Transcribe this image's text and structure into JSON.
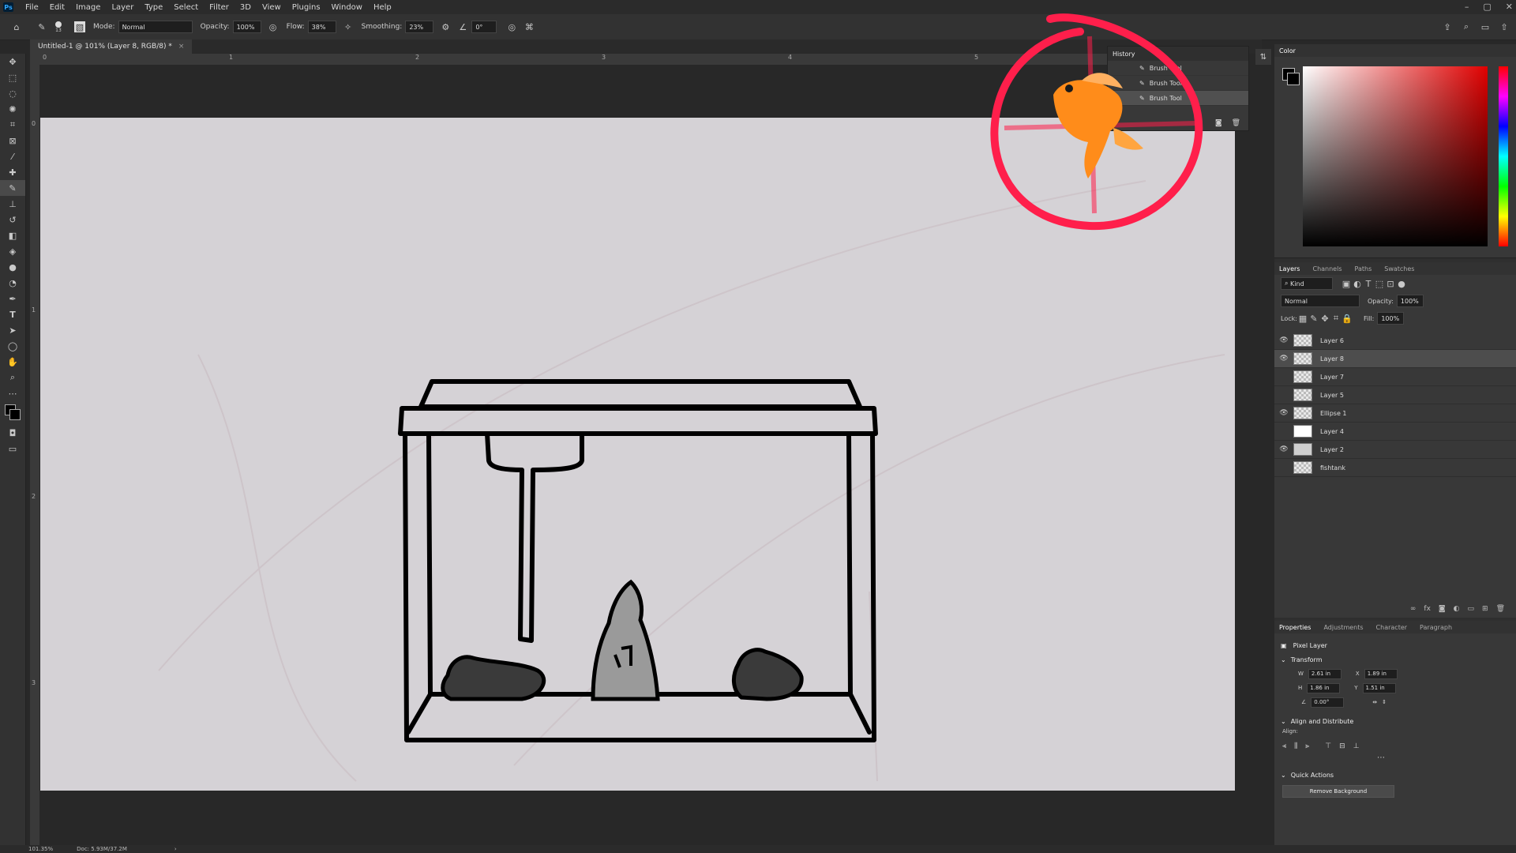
{
  "menu": [
    "File",
    "Edit",
    "Image",
    "Layer",
    "Type",
    "Select",
    "Filter",
    "3D",
    "View",
    "Plugins",
    "Window",
    "Help"
  ],
  "options": {
    "brush_size": "13",
    "mode_label": "Mode:",
    "mode_value": "Normal",
    "opacity_label": "Opacity:",
    "opacity_value": "100%",
    "flow_label": "Flow:",
    "flow_value": "38%",
    "smoothing_label": "Smoothing:",
    "smoothing_value": "23%",
    "angle_value": "0°"
  },
  "document": {
    "tab_title": "Untitled-1 @ 101% (Layer 8, RGB/8) *",
    "ruler_marks": [
      "0",
      "1",
      "2",
      "3",
      "4",
      "5"
    ],
    "ruler_left_marks": [
      "0",
      "1",
      "2",
      "3"
    ]
  },
  "history": {
    "title": "History",
    "items": [
      "Brush Tool",
      "Brush Tool",
      "Brush Tool"
    ]
  },
  "color": {
    "title": "Color"
  },
  "layers": {
    "tabs": [
      "Layers",
      "Channels",
      "Paths",
      "Swatches"
    ],
    "kind_label": "Kind",
    "blend_mode": "Normal",
    "opacity_label": "Opacity:",
    "opacity_value": "100%",
    "lock_label": "Lock:",
    "fill_label": "Fill:",
    "fill_value": "100%",
    "items": [
      {
        "name": "Layer 6",
        "visible": true
      },
      {
        "name": "Layer 8",
        "visible": true,
        "selected": true
      },
      {
        "name": "Layer 7",
        "visible": false
      },
      {
        "name": "Layer 5",
        "visible": false
      },
      {
        "name": "Ellipse 1",
        "visible": true
      },
      {
        "name": "Layer 4",
        "visible": false
      },
      {
        "name": "Layer 2",
        "visible": true
      },
      {
        "name": "fishtank",
        "visible": false
      }
    ]
  },
  "properties": {
    "tabs": [
      "Properties",
      "Adjustments",
      "Character",
      "Paragraph"
    ],
    "pixel_layer": "Pixel Layer",
    "transform_label": "Transform",
    "w_label": "W",
    "w_value": "2.61 in",
    "x_label": "X",
    "x_value": "1.89 in",
    "h_label": "H",
    "h_value": "1.86 in",
    "y_label": "Y",
    "y_value": "1.51 in",
    "angle_value": "0.00°",
    "align_label": "Align and Distribute",
    "align_sub": "Align:",
    "quick_actions": "Quick Actions",
    "remove_bg": "Remove Background"
  },
  "status": {
    "zoom": "101.35%",
    "doc": "Doc: 5.93M/37.2M"
  },
  "colors": {
    "accent_red": "#ff1f4b",
    "fish_orange": "#ff8c1a"
  }
}
